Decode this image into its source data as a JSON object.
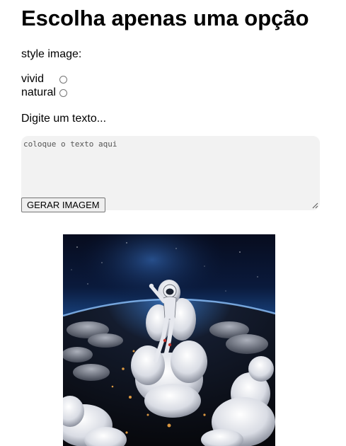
{
  "header": {
    "title": "Escolha apenas uma opção"
  },
  "style_selector": {
    "label": "style image:",
    "options": [
      {
        "label": "vivid",
        "checked": false
      },
      {
        "label": "natural",
        "checked": false
      }
    ]
  },
  "prompt": {
    "label": "Digite um texto...",
    "placeholder": "coloque o texto aqui",
    "value": ""
  },
  "actions": {
    "generate_label": "GERAR IMAGEM"
  },
  "result": {
    "image_subject": "astronaut-on-cloud-above-earth"
  }
}
